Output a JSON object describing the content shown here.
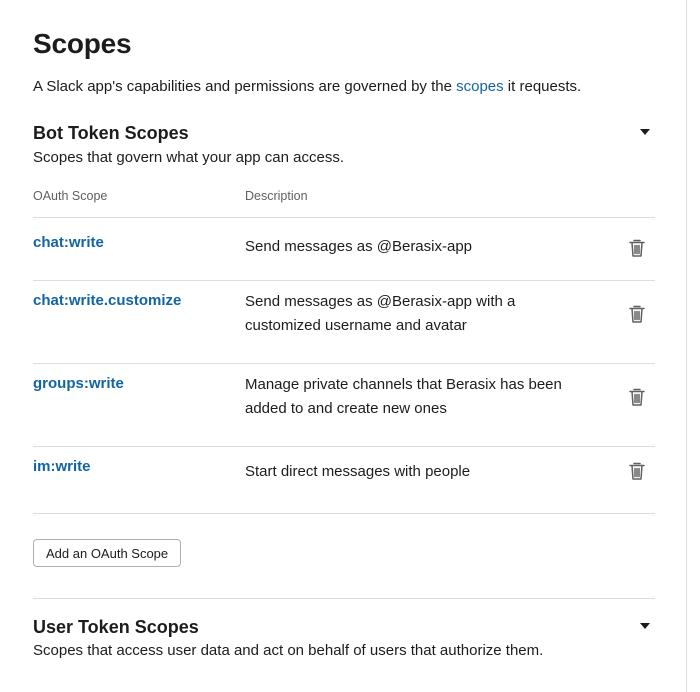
{
  "scopes_section": {
    "title": "Scopes",
    "intro_before": "A Slack app's capabilities and permissions are governed by the ",
    "intro_link": "scopes",
    "intro_after": " it requests."
  },
  "bot_token_scopes": {
    "title": "Bot Token Scopes",
    "description": "Scopes that govern what your app can access.",
    "columns": {
      "scope": "OAuth Scope",
      "description": "Description"
    },
    "rows": [
      {
        "scope": "chat:write",
        "description": "Send messages as @Berasix-app",
        "action_icon": "trash-icon"
      },
      {
        "scope": "chat:write.customize",
        "description": "Send messages as @Berasix-app with a customized username and avatar",
        "action_icon": "trash-icon"
      },
      {
        "scope": "groups:write",
        "description": "Manage private channels that Berasix has been added to and create new ones",
        "action_icon": "trash-icon"
      },
      {
        "scope": "im:write",
        "description": "Start direct messages with people",
        "action_icon": "trash-icon"
      }
    ],
    "add_button": "Add an OAuth Scope",
    "toggle_icon": "caret-down-icon"
  },
  "user_token_scopes": {
    "title": "User Token Scopes",
    "description": "Scopes that access user data and act on behalf of users that authorize them.",
    "toggle_icon": "caret-down-icon"
  },
  "colors": {
    "link": "#1264a3",
    "text": "#1d1c1d",
    "muted": "#616061",
    "border": "#dddddd"
  }
}
